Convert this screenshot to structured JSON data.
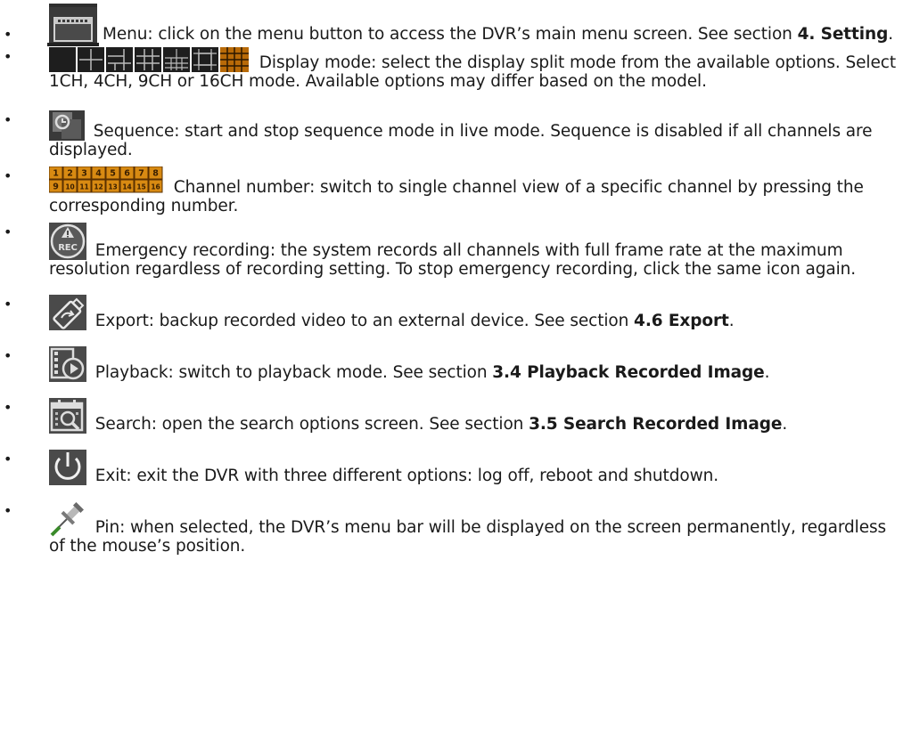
{
  "items": [
    {
      "icon": "menu-icon",
      "label": "Menu",
      "text": ": click on the menu button to access the DVR’s main menu screen. See section ",
      "bold": "4. Setting",
      "tail": "."
    },
    {
      "icon": "display-mode-icons",
      "label": "Display mode",
      "text": ": select the display split mode from the available options. Select 1CH, 4CH, 9CH or 16CH mode. Available options may differ based on the model.",
      "bold": "",
      "tail": ""
    },
    {
      "icon": "sequence-icon",
      "label": "Sequence",
      "text": ": start and stop sequence mode in live mode. Sequence is disabled if all channels are displayed.",
      "bold": "",
      "tail": ""
    },
    {
      "icon": "channel-number-icons",
      "label": "Channel number",
      "text": ": switch to single channel view of a specific channel by pressing the corresponding number.",
      "bold": "",
      "tail": "",
      "channels_row1": [
        "1",
        "2",
        "3",
        "4",
        "5",
        "6",
        "7",
        "8"
      ],
      "channels_row2": [
        "9",
        "10",
        "11",
        "12",
        "13",
        "14",
        "15",
        "16"
      ]
    },
    {
      "icon": "emergency-rec-icon",
      "label": "Emergency recording",
      "text": ": the system records all channels with full frame rate at the maximum resolution regardless of recording setting. To stop emergency recording, click the same icon again.",
      "bold": "",
      "tail": "",
      "icon_text": "REC"
    },
    {
      "icon": "export-icon",
      "label": "Export",
      "text": ": backup recorded video to an external device. See section ",
      "bold": "4.6 Export",
      "tail": "."
    },
    {
      "icon": "playback-icon",
      "label": "Playback",
      "text": ": switch to playback mode. See section ",
      "bold": "3.4 Playback Recorded Image",
      "tail": "."
    },
    {
      "icon": "search-icon",
      "label": "Search",
      "text": ": open the search options screen. See section ",
      "bold": "3.5 Search Recorded Image",
      "tail": "."
    },
    {
      "icon": "power-icon",
      "label": "Exit",
      "text": ": exit the DVR with three different options: log off, reboot and shutdown.",
      "bold": "",
      "tail": ""
    },
    {
      "icon": "pin-icon",
      "label": "Pin",
      "text": ": when selected, the DVR’s menu bar will be displayed on the screen permanently, regardless of the mouse’s position.",
      "bold": "",
      "tail": ""
    }
  ],
  "colors": {
    "icon_dark": "#2b2b2b",
    "icon_orange": "#d88a12",
    "icon_orange_light": "#f0a020",
    "icon_grey": "#8a8a8a"
  }
}
